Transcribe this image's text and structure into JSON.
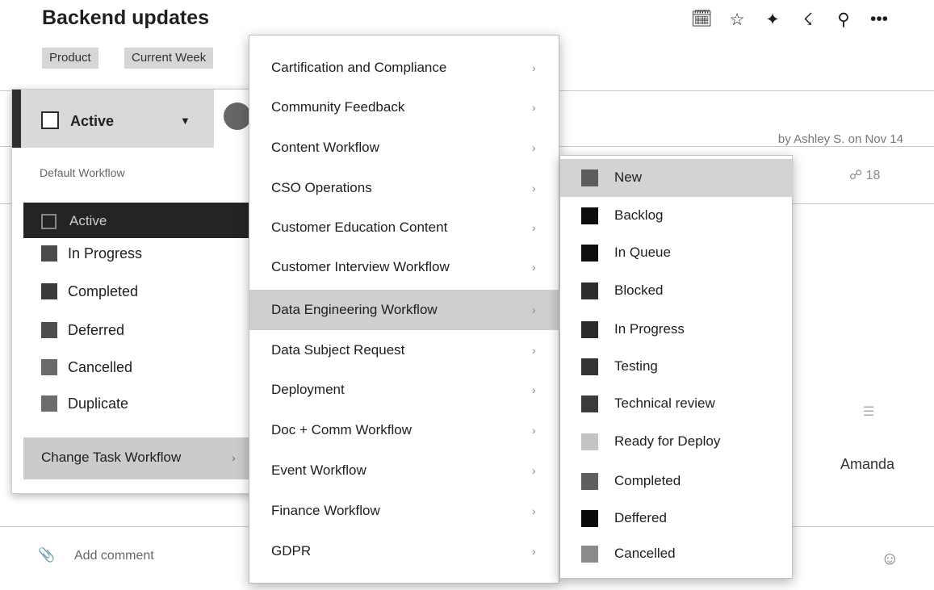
{
  "header": {
    "title": "Backend updates",
    "tags": [
      "Product",
      "Current Week"
    ],
    "toolbar_icons": [
      "calendar-icon",
      "star-icon",
      "pin-icon",
      "rss-icon",
      "link-icon",
      "more-icon"
    ],
    "toolbar_glyphs": [
      "🗓",
      "☆",
      "✦",
      "☇",
      "⚲",
      "•••"
    ]
  },
  "task": {
    "by_line": "by Ashley S. on Nov 14",
    "share_count": "18",
    "assignee": "Amanda",
    "comment_placeholder": "Add comment"
  },
  "status_panel": {
    "current": "Active",
    "workflow_label": "Default Workflow",
    "items": [
      {
        "label": "Active",
        "color": "#2a2a2a",
        "selected": true
      },
      {
        "label": "In Progress",
        "color": "#4b4b4b"
      },
      {
        "label": "Completed",
        "color": "#3a3a3a"
      },
      {
        "label": "Deferred",
        "color": "#4e4e4e"
      },
      {
        "label": "Cancelled",
        "color": "#6a6a6a"
      },
      {
        "label": "Duplicate",
        "color": "#6c6c6c"
      }
    ],
    "change_label": "Change Task Workflow",
    "change_chevron": "›"
  },
  "workflow_menu": {
    "chevron": "›",
    "items": [
      {
        "label": "Cartification and Compliance"
      },
      {
        "label": "Community Feedback"
      },
      {
        "label": "Content Workflow"
      },
      {
        "label": "CSO Operations"
      },
      {
        "label": "Customer Education Content"
      },
      {
        "label": "Customer Interview Workflow"
      },
      {
        "label": "Data Engineering Workflow",
        "highlighted": true
      },
      {
        "label": "Data Subject Request"
      },
      {
        "label": "Deployment"
      },
      {
        "label": "Doc + Comm Workflow"
      },
      {
        "label": "Event Workflow"
      },
      {
        "label": "Finance Workflow"
      },
      {
        "label": "GDPR"
      }
    ]
  },
  "state_menu": {
    "items": [
      {
        "label": "New",
        "color": "#5c5c5c",
        "highlighted": true
      },
      {
        "label": "Backlog",
        "color": "#0d0d0d"
      },
      {
        "label": "In Queue",
        "color": "#0f0f0f"
      },
      {
        "label": "Blocked",
        "color": "#2e2e2e"
      },
      {
        "label": "In Progress",
        "color": "#2b2b2b"
      },
      {
        "label": "Testing",
        "color": "#333333"
      },
      {
        "label": "Technical review",
        "color": "#3b3b3b"
      },
      {
        "label": "Ready for Deploy",
        "color": "#c4c4c4"
      },
      {
        "label": "Completed",
        "color": "#5f5f5f"
      },
      {
        "label": "Deffered",
        "color": "#0a0a0a"
      },
      {
        "label": "Cancelled",
        "color": "#8a8a8a"
      }
    ]
  }
}
